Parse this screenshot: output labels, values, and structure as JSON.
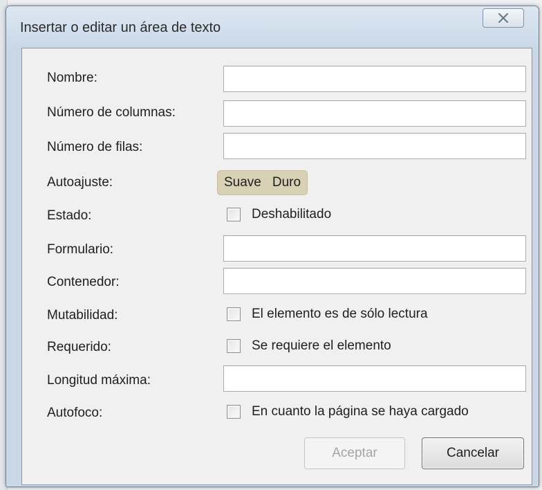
{
  "dialog": {
    "title": "Insertar o editar un área de texto",
    "close_icon": "close-icon"
  },
  "fields": {
    "nombre": {
      "label": "Nombre:",
      "value": ""
    },
    "columnas": {
      "label": "Número de columnas:",
      "value": ""
    },
    "filas": {
      "label": "Número de filas:",
      "value": ""
    },
    "autoajuste": {
      "label": "Autoajuste:",
      "options": [
        "Suave",
        "Duro"
      ]
    },
    "estado": {
      "label": "Estado:",
      "checkbox_label": "Deshabilitado",
      "checked": false
    },
    "formulario": {
      "label": "Formulario:",
      "value": ""
    },
    "contenedor": {
      "label": "Contenedor:",
      "value": ""
    },
    "mutabilidad": {
      "label": "Mutabilidad:",
      "checkbox_label": "El elemento es de sólo lectura",
      "checked": false
    },
    "requerido": {
      "label": "Requerido:",
      "checkbox_label": "Se requiere el elemento",
      "checked": false
    },
    "longitud": {
      "label": "Longitud máxima:",
      "value": ""
    },
    "autofoco": {
      "label": "Autofoco:",
      "checkbox_label": "En cuanto la página se haya cargado",
      "checked": false
    }
  },
  "buttons": {
    "accept": "Aceptar",
    "cancel": "Cancelar"
  }
}
